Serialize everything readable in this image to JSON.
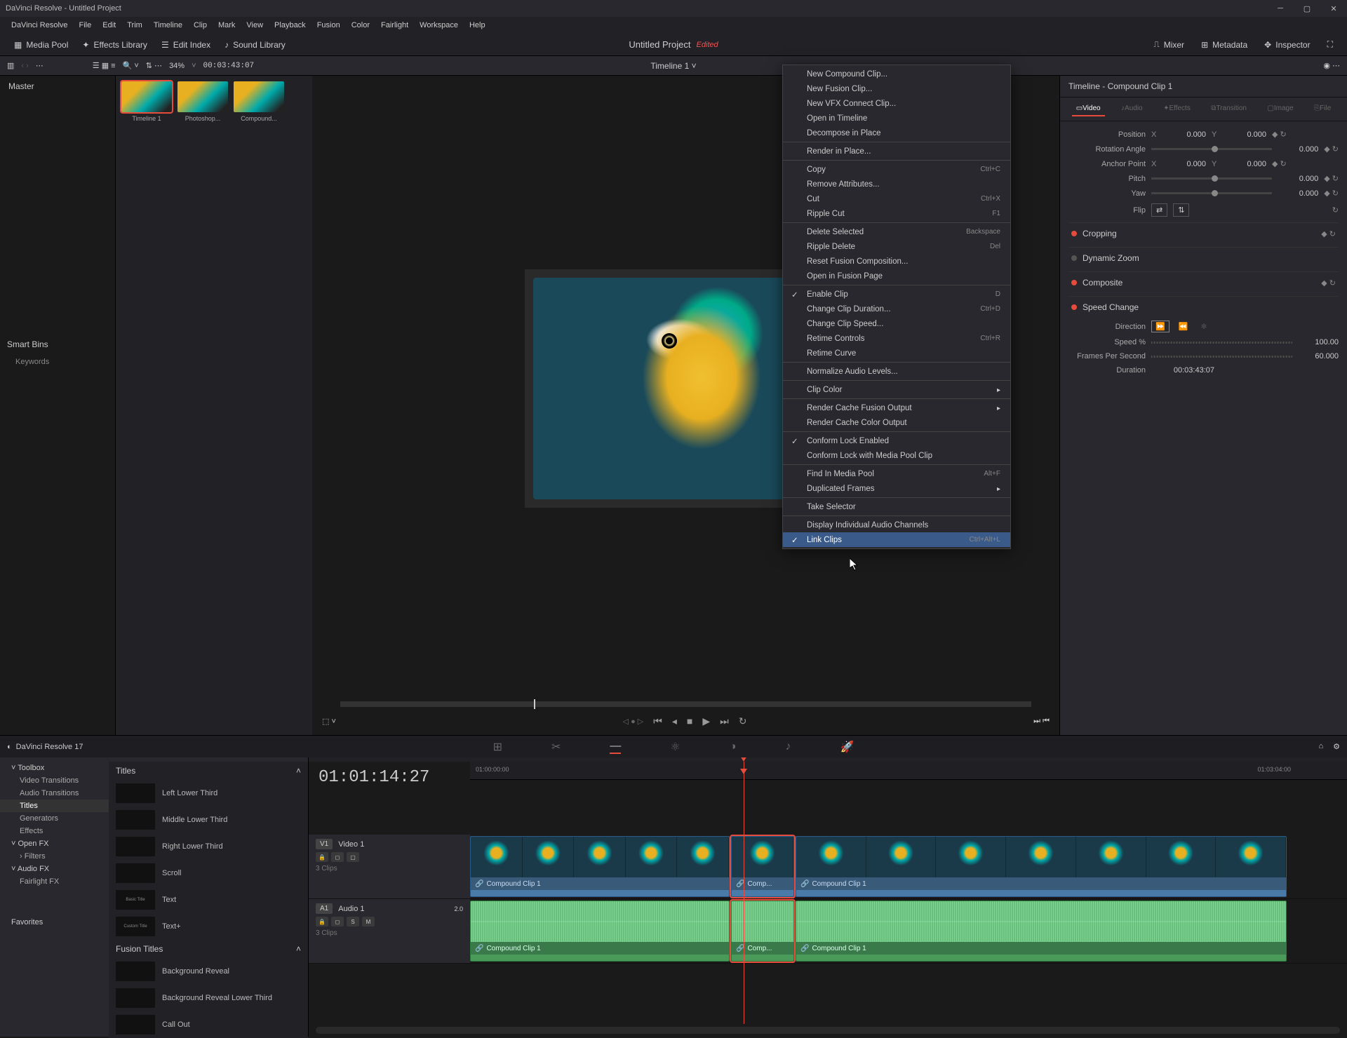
{
  "titlebar": {
    "title": "DaVinci Resolve - Untitled Project"
  },
  "menubar": [
    "DaVinci Resolve",
    "File",
    "Edit",
    "Trim",
    "Timeline",
    "Clip",
    "Mark",
    "View",
    "Playback",
    "Fusion",
    "Color",
    "Fairlight",
    "Workspace",
    "Help"
  ],
  "toolbar": {
    "media_pool": "Media Pool",
    "effects_library": "Effects Library",
    "edit_index": "Edit Index",
    "sound_library": "Sound Library",
    "project_title": "Untitled Project",
    "edited": "Edited",
    "mixer": "Mixer",
    "metadata": "Metadata",
    "inspector": "Inspector"
  },
  "browser": {
    "zoom": "34%",
    "timecode": "00:03:43:07",
    "timeline_name": "Timeline 1"
  },
  "media_pool": {
    "master": "Master",
    "smart_bins": "Smart Bins",
    "keywords": "Keywords",
    "favorites": "Favorites",
    "clips": [
      {
        "label": "Timeline 1",
        "selected": true
      },
      {
        "label": "Photoshop..."
      },
      {
        "label": "Compound..."
      }
    ]
  },
  "effects": {
    "toolbox": "Toolbox",
    "items": [
      {
        "label": "Video Transitions"
      },
      {
        "label": "Audio Transitions"
      },
      {
        "label": "Titles",
        "active": true
      },
      {
        "label": "Generators"
      },
      {
        "label": "Effects"
      }
    ],
    "open_fx": "Open FX",
    "filters": "Filters",
    "audio_fx": "Audio FX",
    "fairlight_fx": "Fairlight FX",
    "titles_header": "Titles",
    "titles": [
      "Left Lower Third",
      "Middle Lower Third",
      "Right Lower Third",
      "Scroll",
      "Text",
      "Text+"
    ],
    "fusion_titles_header": "Fusion Titles",
    "fusion_titles": [
      "Background Reveal",
      "Background Reveal Lower Third",
      "Call Out"
    ]
  },
  "timeline": {
    "timecode_big": "01:01:14:27",
    "ruler_start": "01:00:00:00",
    "ruler_end": "01:03:04:00",
    "v1": {
      "badge": "V1",
      "name": "Video 1",
      "clips_info": "3 Clips"
    },
    "a1": {
      "badge": "A1",
      "name": "Audio 1",
      "ch": "2.0",
      "clips_info": "3 Clips",
      "s": "S",
      "m": "M"
    },
    "clip_name": "Compound Clip 1",
    "clip_name_short": "Comp..."
  },
  "context_menu": [
    {
      "t": "item",
      "label": "New Compound Clip..."
    },
    {
      "t": "item",
      "label": "New Fusion Clip..."
    },
    {
      "t": "item",
      "label": "New VFX Connect Clip..."
    },
    {
      "t": "item",
      "label": "Open in Timeline"
    },
    {
      "t": "item",
      "label": "Decompose in Place"
    },
    {
      "t": "sep"
    },
    {
      "t": "item",
      "label": "Render in Place..."
    },
    {
      "t": "sep"
    },
    {
      "t": "item",
      "label": "Copy",
      "sc": "Ctrl+C"
    },
    {
      "t": "item",
      "label": "Remove Attributes..."
    },
    {
      "t": "item",
      "label": "Cut",
      "sc": "Ctrl+X"
    },
    {
      "t": "item",
      "label": "Ripple Cut",
      "sc": "F1"
    },
    {
      "t": "sep"
    },
    {
      "t": "item",
      "label": "Delete Selected",
      "sc": "Backspace"
    },
    {
      "t": "item",
      "label": "Ripple Delete",
      "sc": "Del"
    },
    {
      "t": "item",
      "label": "Reset Fusion Composition..."
    },
    {
      "t": "item",
      "label": "Open in Fusion Page"
    },
    {
      "t": "sep"
    },
    {
      "t": "item",
      "label": "Enable Clip",
      "sc": "D",
      "check": true
    },
    {
      "t": "item",
      "label": "Change Clip Duration...",
      "sc": "Ctrl+D"
    },
    {
      "t": "item",
      "label": "Change Clip Speed..."
    },
    {
      "t": "item",
      "label": "Retime Controls",
      "sc": "Ctrl+R"
    },
    {
      "t": "item",
      "label": "Retime Curve"
    },
    {
      "t": "sep"
    },
    {
      "t": "item",
      "label": "Normalize Audio Levels..."
    },
    {
      "t": "sep"
    },
    {
      "t": "item",
      "label": "Clip Color",
      "sub": true
    },
    {
      "t": "sep"
    },
    {
      "t": "item",
      "label": "Render Cache Fusion Output",
      "sub": true
    },
    {
      "t": "item",
      "label": "Render Cache Color Output"
    },
    {
      "t": "sep"
    },
    {
      "t": "item",
      "label": "Conform Lock Enabled",
      "check": true
    },
    {
      "t": "item",
      "label": "Conform Lock with Media Pool Clip"
    },
    {
      "t": "sep"
    },
    {
      "t": "item",
      "label": "Find In Media Pool",
      "sc": "Alt+F"
    },
    {
      "t": "item",
      "label": "Duplicated Frames",
      "sub": true
    },
    {
      "t": "sep"
    },
    {
      "t": "item",
      "label": "Take Selector"
    },
    {
      "t": "sep"
    },
    {
      "t": "item",
      "label": "Display Individual Audio Channels"
    },
    {
      "t": "item",
      "label": "Link Clips",
      "sc": "Ctrl+Alt+L",
      "check": true,
      "hover": true
    }
  ],
  "inspector": {
    "header": "Timeline - Compound Clip 1",
    "tabs": {
      "video": "Video",
      "audio": "Audio",
      "effects": "Effects",
      "transition": "Transition",
      "image": "Image",
      "file": "File"
    },
    "position": {
      "label": "Position",
      "x": "0.000",
      "y": "0.000"
    },
    "rotation": {
      "label": "Rotation Angle",
      "val": "0.000"
    },
    "anchor": {
      "label": "Anchor Point",
      "x": "0.000",
      "y": "0.000"
    },
    "pitch": {
      "label": "Pitch",
      "val": "0.000"
    },
    "yaw": {
      "label": "Yaw",
      "val": "0.000"
    },
    "flip": {
      "label": "Flip"
    },
    "cropping": "Cropping",
    "dynamic_zoom": "Dynamic Zoom",
    "composite": "Composite",
    "speed_change": "Speed Change",
    "direction": "Direction",
    "speed_pct": {
      "label": "Speed %",
      "val": "100.00"
    },
    "fps": {
      "label": "Frames Per Second",
      "val": "60.000"
    },
    "duration": {
      "label": "Duration",
      "val": "00:03:43:07"
    }
  },
  "footer": {
    "app": "DaVinci Resolve 17"
  }
}
